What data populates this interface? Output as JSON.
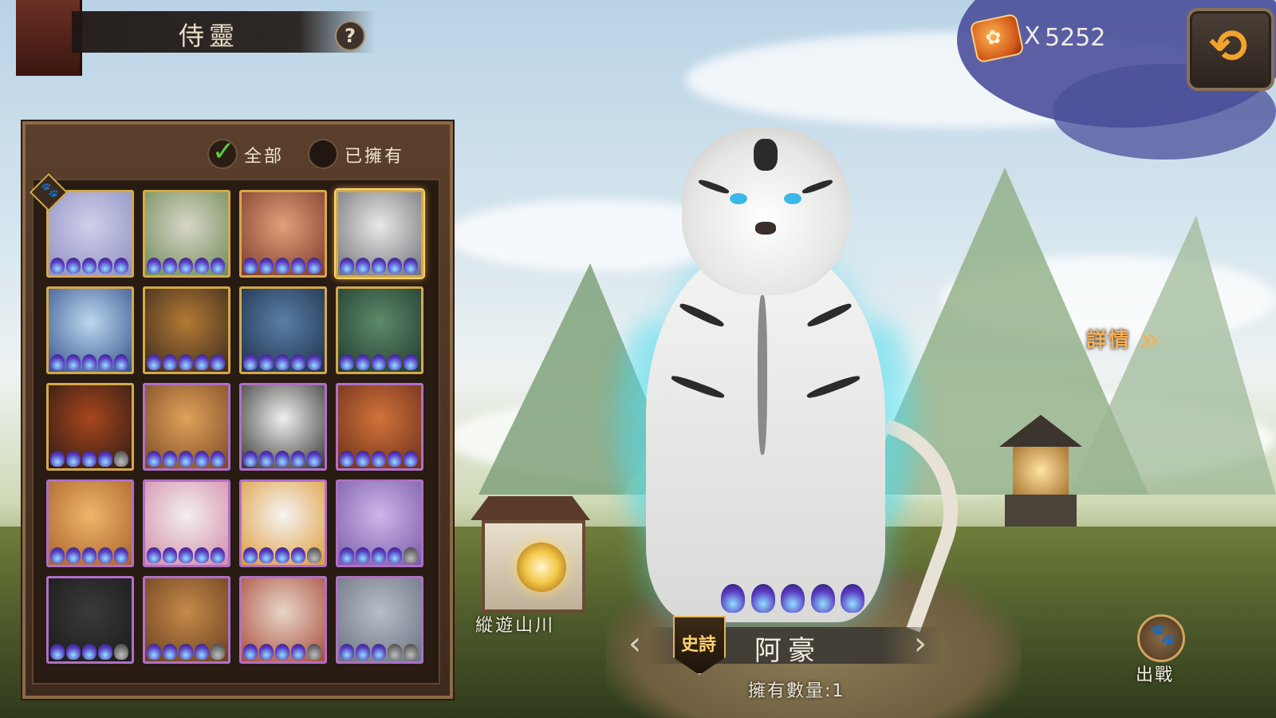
{
  "header": {
    "title": "侍靈",
    "help_label": "?"
  },
  "currency": {
    "icon": "paw-token-icon",
    "prefix": "X",
    "amount": "5252"
  },
  "back_button": {
    "icon": "back-arrow-icon",
    "glyph": "⟲"
  },
  "filters": {
    "all_label": "全部",
    "owned_label": "已擁有",
    "all_checked": true
  },
  "grid": {
    "tiles": [
      {
        "name": "white-haired-spirit",
        "frame": "gold",
        "colors": [
          "#cfd0ea",
          "#8e8fc0"
        ],
        "stars": 5
      },
      {
        "name": "white-deer",
        "frame": "gold",
        "colors": [
          "#d8d6c8",
          "#6f8a55"
        ],
        "stars": 5
      },
      {
        "name": "red-fairy-girl",
        "frame": "gold",
        "colors": [
          "#e2a07a",
          "#7a3a2a"
        ],
        "stars": 5
      },
      {
        "name": "white-tiger",
        "frame": "gold",
        "colors": [
          "#e8e8e6",
          "#6f7278"
        ],
        "stars": 5
      },
      {
        "name": "ice-dragon",
        "frame": "gold",
        "colors": [
          "#bcd8f0",
          "#36518a"
        ],
        "stars": 5
      },
      {
        "name": "golden-dragon",
        "frame": "gold",
        "colors": [
          "#b47a34",
          "#3a2a1f"
        ],
        "stars": 5
      },
      {
        "name": "azure-dragon",
        "frame": "gold",
        "colors": [
          "#5a7fa8",
          "#1e2f48"
        ],
        "stars": 5
      },
      {
        "name": "jade-turtle",
        "frame": "gold",
        "colors": [
          "#5e8a6a",
          "#1f3a2c"
        ],
        "stars": 5
      },
      {
        "name": "fire-qilin",
        "frame": "gold",
        "colors": [
          "#a8461d",
          "#2b1b14"
        ],
        "stars": 4
      },
      {
        "name": "tiger-cub",
        "frame": "purple",
        "colors": [
          "#e0a25a",
          "#7a4a26"
        ],
        "stars": 5
      },
      {
        "name": "panda",
        "frame": "purple",
        "colors": [
          "#f0f0ee",
          "#333333"
        ],
        "stars": 5
      },
      {
        "name": "red-bear",
        "frame": "purple",
        "colors": [
          "#d2733a",
          "#6a2f1a"
        ],
        "stars": 5
      },
      {
        "name": "orange-fox",
        "frame": "purple",
        "colors": [
          "#f0b56a",
          "#a8622a"
        ],
        "stars": 5
      },
      {
        "name": "white-rabbit",
        "frame": "purple",
        "colors": [
          "#f2eef0",
          "#d48aa8"
        ],
        "stars": 5
      },
      {
        "name": "white-duck",
        "frame": "purple",
        "colors": [
          "#f4f4f2",
          "#e09a3a"
        ],
        "stars": 4
      },
      {
        "name": "lavender-cat",
        "frame": "purple",
        "colors": [
          "#cdb6e8",
          "#7a5aa8"
        ],
        "stars": 4
      },
      {
        "name": "black-cat",
        "frame": "purple",
        "colors": [
          "#3a3a3a",
          "#1a1a1a"
        ],
        "stars": 4
      },
      {
        "name": "owl",
        "frame": "purple",
        "colors": [
          "#c58a4a",
          "#6a3f1f"
        ],
        "stars": 4
      },
      {
        "name": "monkey-king",
        "frame": "purple",
        "colors": [
          "#e8d6c8",
          "#a84a3a"
        ],
        "stars": 4
      },
      {
        "name": "elephant",
        "frame": "purple",
        "colors": [
          "#b8bec8",
          "#6a7280"
        ],
        "stars": 3
      }
    ]
  },
  "details": {
    "label": "詳情",
    "chevron": "»"
  },
  "wander": {
    "label": "縱遊山川"
  },
  "selected_pet": {
    "stars": 5,
    "rarity": "史詩",
    "name": "阿豪",
    "owned_count": "擁有數量:1",
    "prev_glyph": "‹",
    "next_glyph": "›"
  },
  "deploy": {
    "label": "出戰",
    "icon": "paw-icon"
  }
}
